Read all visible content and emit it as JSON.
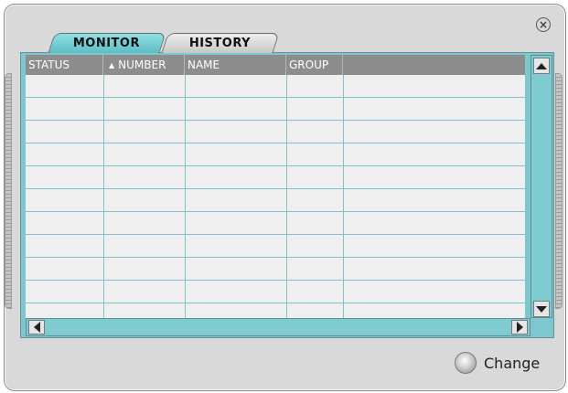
{
  "window": {
    "close_icon": "close-icon"
  },
  "tabs": [
    {
      "label": "MONITOR",
      "active": true
    },
    {
      "label": "HISTORY",
      "active": false
    }
  ],
  "table": {
    "columns": [
      {
        "label": "STATUS",
        "sorted": false
      },
      {
        "label": "NUMBER",
        "sorted": true,
        "sort_direction": "ascending"
      },
      {
        "label": "NAME",
        "sorted": false
      },
      {
        "label": "GROUP",
        "sorted": false
      },
      {
        "label": "",
        "sorted": false
      }
    ],
    "rows": []
  },
  "footer": {
    "change_label": "Change"
  },
  "colors": {
    "accent": "#7fc7cf",
    "header": "#8d8d8d",
    "background": "#d9d9d9"
  }
}
